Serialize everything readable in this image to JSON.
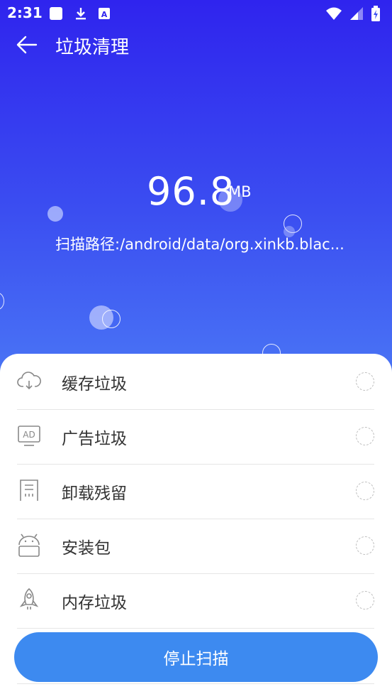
{
  "status_bar": {
    "time": "2:31",
    "icons": [
      "white-square-icon",
      "download-icon",
      "a-badge-icon",
      "wifi-icon",
      "signal-icon",
      "battery-icon"
    ]
  },
  "app_bar": {
    "title": "垃圾清理",
    "back_icon": "back-arrow-icon"
  },
  "scan": {
    "size": "96.8",
    "unit": "MB",
    "path": "扫描路径:/android/data/org.xinkb.blac..."
  },
  "items": [
    {
      "label": "缓存垃圾",
      "icon": "cloud-download-icon"
    },
    {
      "label": "广告垃圾",
      "icon": "ad-icon"
    },
    {
      "label": "卸载残留",
      "icon": "uninstall-residue-icon"
    },
    {
      "label": "安装包",
      "icon": "android-icon"
    },
    {
      "label": "内存垃圾",
      "icon": "rocket-icon"
    }
  ],
  "stop_button_label": "停止扫描",
  "colors": {
    "hero_top": "#2f24ee",
    "hero_bottom": "#4a76f5",
    "button": "#3d8af0"
  }
}
